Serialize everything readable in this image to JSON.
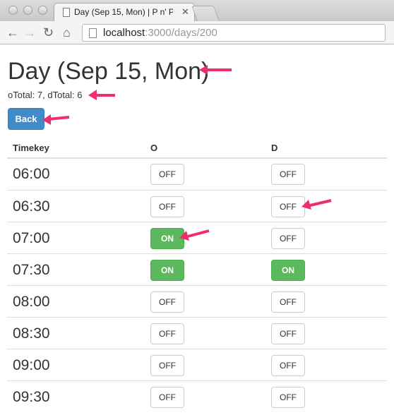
{
  "browser": {
    "tab_title": "Day (Sep 15, Mon) | P n' P",
    "tab_close": "✕",
    "url_host": "localhost",
    "url_path": ":3000/days/200"
  },
  "page": {
    "title": "Day (Sep 15, Mon)",
    "totals": "oTotal: 7, dTotal: 6",
    "back_label": "Back"
  },
  "table": {
    "headers": {
      "timekey": "Timekey",
      "o": "O",
      "d": "D"
    },
    "rows": [
      {
        "time": "06:00",
        "o": "OFF",
        "d": "OFF"
      },
      {
        "time": "06:30",
        "o": "OFF",
        "d": "OFF"
      },
      {
        "time": "07:00",
        "o": "ON",
        "d": "OFF"
      },
      {
        "time": "07:30",
        "o": "ON",
        "d": "ON"
      },
      {
        "time": "08:00",
        "o": "OFF",
        "d": "OFF"
      },
      {
        "time": "08:30",
        "o": "OFF",
        "d": "OFF"
      },
      {
        "time": "09:00",
        "o": "OFF",
        "d": "OFF"
      },
      {
        "time": "09:30",
        "o": "OFF",
        "d": "OFF"
      }
    ]
  },
  "colors": {
    "primary": "#428bca",
    "success": "#5cb85c",
    "annotation": "#ec2f6c"
  }
}
